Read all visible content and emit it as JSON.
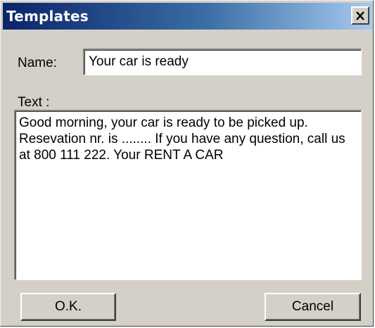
{
  "window": {
    "title": "Templates",
    "close_glyph": "close-icon"
  },
  "form": {
    "name_label": "Name:",
    "name_value": "Your car is ready",
    "text_label": "Text :",
    "text_value": "Good morning, your car is ready to be picked up. Resevation nr. is ........ If you have any question, call us at 800 111 222. Your RENT A CAR"
  },
  "buttons": {
    "ok_label": "O.K.",
    "cancel_label": "Cancel"
  },
  "colors": {
    "titlebar_start": "#0a246a",
    "titlebar_end": "#a6caf0",
    "dialog_face": "#d4d0c8"
  }
}
